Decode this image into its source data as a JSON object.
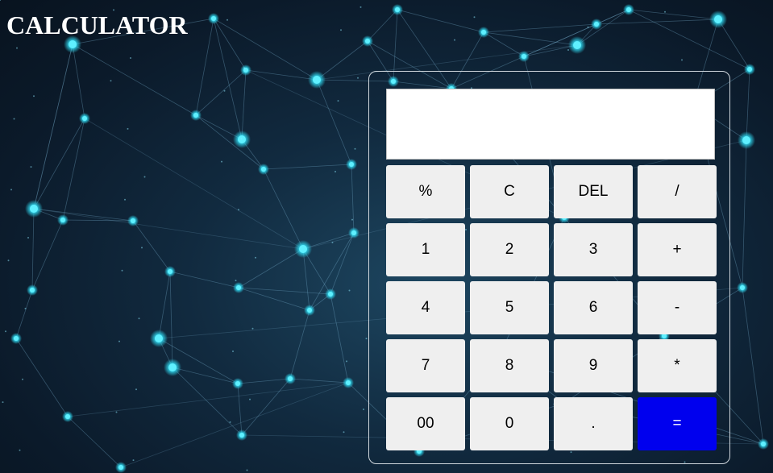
{
  "app": {
    "title": "CALCULATOR"
  },
  "display": {
    "value": ""
  },
  "keys": [
    {
      "label": "%",
      "name": "percent-button"
    },
    {
      "label": "C",
      "name": "clear-button"
    },
    {
      "label": "DEL",
      "name": "delete-button"
    },
    {
      "label": "/",
      "name": "divide-button"
    },
    {
      "label": "1",
      "name": "digit-1-button"
    },
    {
      "label": "2",
      "name": "digit-2-button"
    },
    {
      "label": "3",
      "name": "digit-3-button"
    },
    {
      "label": "+",
      "name": "add-button"
    },
    {
      "label": "4",
      "name": "digit-4-button"
    },
    {
      "label": "5",
      "name": "digit-5-button"
    },
    {
      "label": "6",
      "name": "digit-6-button"
    },
    {
      "label": "-",
      "name": "subtract-button"
    },
    {
      "label": "7",
      "name": "digit-7-button"
    },
    {
      "label": "8",
      "name": "digit-8-button"
    },
    {
      "label": "9",
      "name": "digit-9-button"
    },
    {
      "label": "*",
      "name": "multiply-button"
    },
    {
      "label": "00",
      "name": "double-zero-button"
    },
    {
      "label": "0",
      "name": "digit-0-button"
    },
    {
      "label": ".",
      "name": "decimal-button"
    },
    {
      "label": "=",
      "name": "equals-button"
    }
  ],
  "colors": {
    "key_background": "#efefef",
    "equals_background": "#0000ee",
    "equals_text": "#ffffff",
    "title_text": "#ffffff",
    "panel_border": "#cfd6dc"
  },
  "background": {
    "description_icon": "network-nodes-background"
  }
}
